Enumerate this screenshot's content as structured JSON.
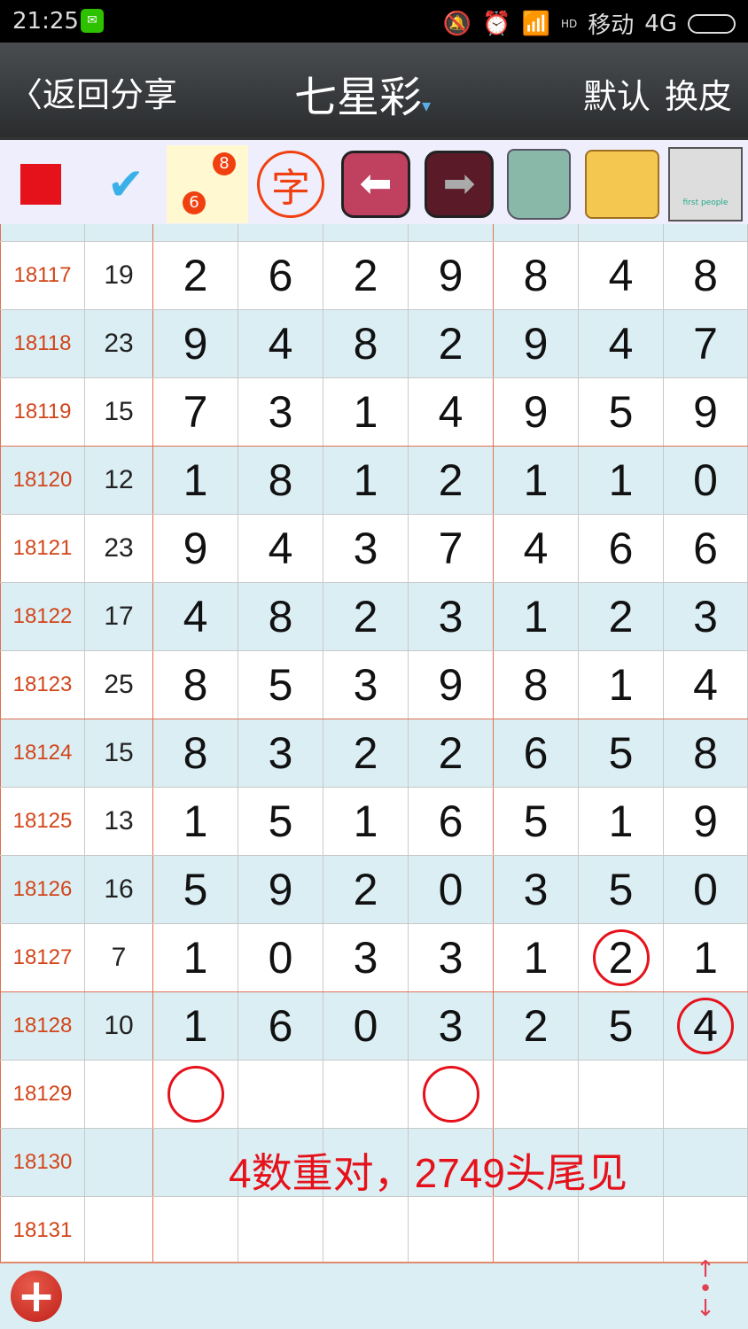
{
  "status": {
    "time": "21:25",
    "carrier": "移动",
    "network": "4G",
    "hd": "HD"
  },
  "header": {
    "back": "返回",
    "share": "分享",
    "title": "七星彩",
    "default": "默认",
    "skin": "换皮"
  },
  "toolbar": {
    "icons": [
      "red-square-icon",
      "check-lasso-icon",
      "link-6-8-icon",
      "zi-character-icon",
      "back-arrow-icon",
      "forward-arrow-icon",
      "trash-icon",
      "photo-folder-icon",
      "floppy-save-icon"
    ],
    "link_a": "6",
    "link_b": "8",
    "zi": "字",
    "floppy_text": "first people"
  },
  "colors": {
    "issue": "#d2451a",
    "accent": "#e5121b",
    "row_alt": "#dbeef4"
  },
  "rows": [
    {
      "issue": "18117",
      "sum": "19",
      "digits": [
        "2",
        "6",
        "2",
        "9",
        "8",
        "4",
        "8"
      ]
    },
    {
      "issue": "18118",
      "sum": "23",
      "digits": [
        "9",
        "4",
        "8",
        "2",
        "9",
        "4",
        "7"
      ]
    },
    {
      "issue": "18119",
      "sum": "15",
      "digits": [
        "7",
        "3",
        "1",
        "4",
        "9",
        "5",
        "9"
      ]
    },
    {
      "issue": "18120",
      "sum": "12",
      "digits": [
        "1",
        "8",
        "1",
        "2",
        "1",
        "1",
        "0"
      ]
    },
    {
      "issue": "18121",
      "sum": "23",
      "digits": [
        "9",
        "4",
        "3",
        "7",
        "4",
        "6",
        "6"
      ]
    },
    {
      "issue": "18122",
      "sum": "17",
      "digits": [
        "4",
        "8",
        "2",
        "3",
        "1",
        "2",
        "3"
      ]
    },
    {
      "issue": "18123",
      "sum": "25",
      "digits": [
        "8",
        "5",
        "3",
        "9",
        "8",
        "1",
        "4"
      ]
    },
    {
      "issue": "18124",
      "sum": "15",
      "digits": [
        "8",
        "3",
        "2",
        "2",
        "6",
        "5",
        "8"
      ]
    },
    {
      "issue": "18125",
      "sum": "13",
      "digits": [
        "1",
        "5",
        "1",
        "6",
        "5",
        "1",
        "9"
      ]
    },
    {
      "issue": "18126",
      "sum": "16",
      "digits": [
        "5",
        "9",
        "2",
        "0",
        "3",
        "5",
        "0"
      ]
    },
    {
      "issue": "18127",
      "sum": "7",
      "digits": [
        "1",
        "0",
        "3",
        "3",
        "1",
        "2",
        "1"
      ],
      "circled": [
        5
      ]
    },
    {
      "issue": "18128",
      "sum": "10",
      "digits": [
        "1",
        "6",
        "0",
        "3",
        "2",
        "5",
        "4"
      ],
      "circled": [
        6
      ]
    },
    {
      "issue": "18129",
      "sum": "",
      "digits": [
        "",
        "",
        "",
        "",
        "",
        "",
        ""
      ],
      "circled": [
        0,
        3
      ]
    },
    {
      "issue": "18130",
      "sum": "",
      "digits": [
        "",
        "",
        "",
        "",
        "",
        "",
        ""
      ]
    },
    {
      "issue": "18131",
      "sum": "",
      "digits": [
        "",
        "",
        "",
        "",
        "",
        "",
        ""
      ]
    }
  ],
  "note": "4数重对，2749头尾见",
  "footer": {
    "add": "+"
  }
}
